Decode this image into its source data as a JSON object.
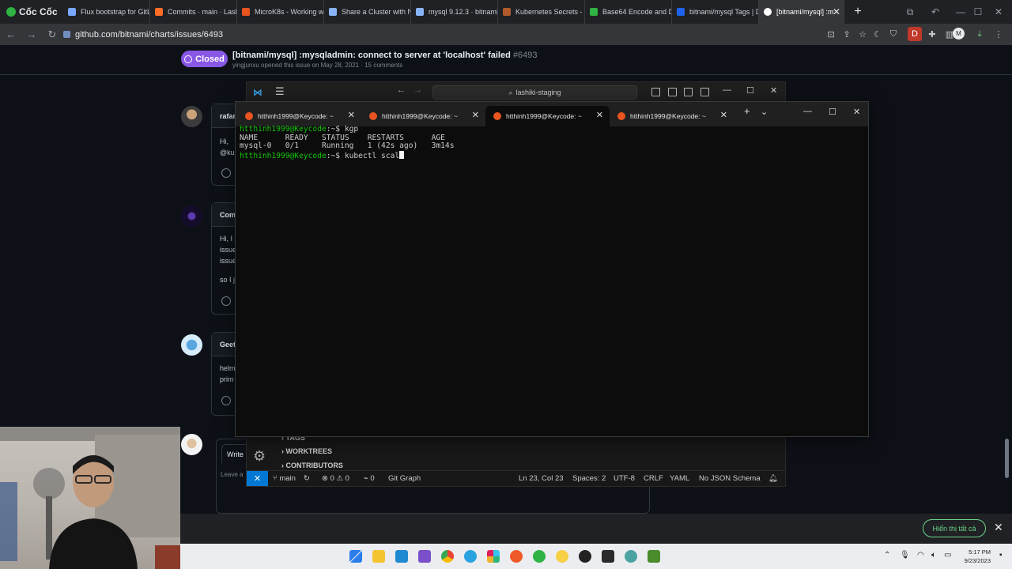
{
  "browser": {
    "brand": "Cốc Cốc",
    "tabs": [
      {
        "title": "Flux bootstrap for GitLab",
        "color": "#7aa7ff"
      },
      {
        "title": "Commits · main · Lashiki",
        "color": "#fc6d26"
      },
      {
        "title": "MicroK8s - Working with",
        "color": "#e95420"
      },
      {
        "title": "Share a Cluster with Na",
        "color": "#8ab4f8"
      },
      {
        "title": "mysql 9.12.3 · bitnami/",
        "color": "#8ab4f8"
      },
      {
        "title": "Kubernetes Secrets - W",
        "color": "#b05a2a"
      },
      {
        "title": "Base64 Encode and De",
        "color": "#2fb344"
      },
      {
        "title": "bitnami/mysql Tags | D",
        "color": "#1d63ed"
      },
      {
        "title": "[bitnami/mysql] :m",
        "color": "#ffffff",
        "active": true
      }
    ],
    "url": "github.com/bitnami/charts/issues/6493"
  },
  "issue": {
    "state": "Closed",
    "title": "[bitnami/mysql] :mysqladmin: connect to server at 'localhost' failed",
    "number": "#6493",
    "author": "yingjunxu",
    "meta": " opened this issue on May 28, 2021 · 15 comments"
  },
  "comments": [
    {
      "author": "rafar",
      "lines": [
        "Hi,",
        "@ku"
      ]
    },
    {
      "author": "Com",
      "lines": [
        "Hi, I",
        "issue",
        "issue",
        "",
        "so I j"
      ]
    },
    {
      "author": "Geet",
      "lines": [
        "helm",
        "prim"
      ]
    }
  ],
  "comment_box": {
    "tab": "Write",
    "placeholder": "Leave a"
  },
  "vscode": {
    "search": "lashiki-staging",
    "sections": [
      "TAGS",
      "WORKTREES",
      "CONTRIBUTORS"
    ],
    "status": {
      "branch": "main",
      "problems": "⊗ 0 ⚠ 0",
      "ports": "0",
      "gitgraph": "Git Graph",
      "position": "Ln 23, Col 23",
      "spaces": "Spaces: 2",
      "encoding": "UTF-8",
      "eol": "CRLF",
      "language": "YAML",
      "schema": "No JSON Schema"
    }
  },
  "terminal": {
    "tabs": [
      "htthinh1999@Keycode: ~",
      "htthinh1999@Keycode: ~",
      "htthinh1999@Keycode: ~",
      "htthinh1999@Keycode: ~"
    ],
    "active_tab": 2,
    "prompt1": "htthinh1999@Keycode",
    "cmd1": ":~$ kgp",
    "header": "NAME      READY   STATUS    RESTARTS      AGE",
    "row": "mysql-0   0/1     Running   1 (42s ago)   3m14s",
    "prompt2": "htthinh1999@Keycode",
    "cmd2": ":~$ kubectl scal"
  },
  "downloads": {
    "show_all": "Hiển thị tất cả"
  },
  "clock": {
    "time": "5:17 PM",
    "date": "9/23/2023"
  }
}
